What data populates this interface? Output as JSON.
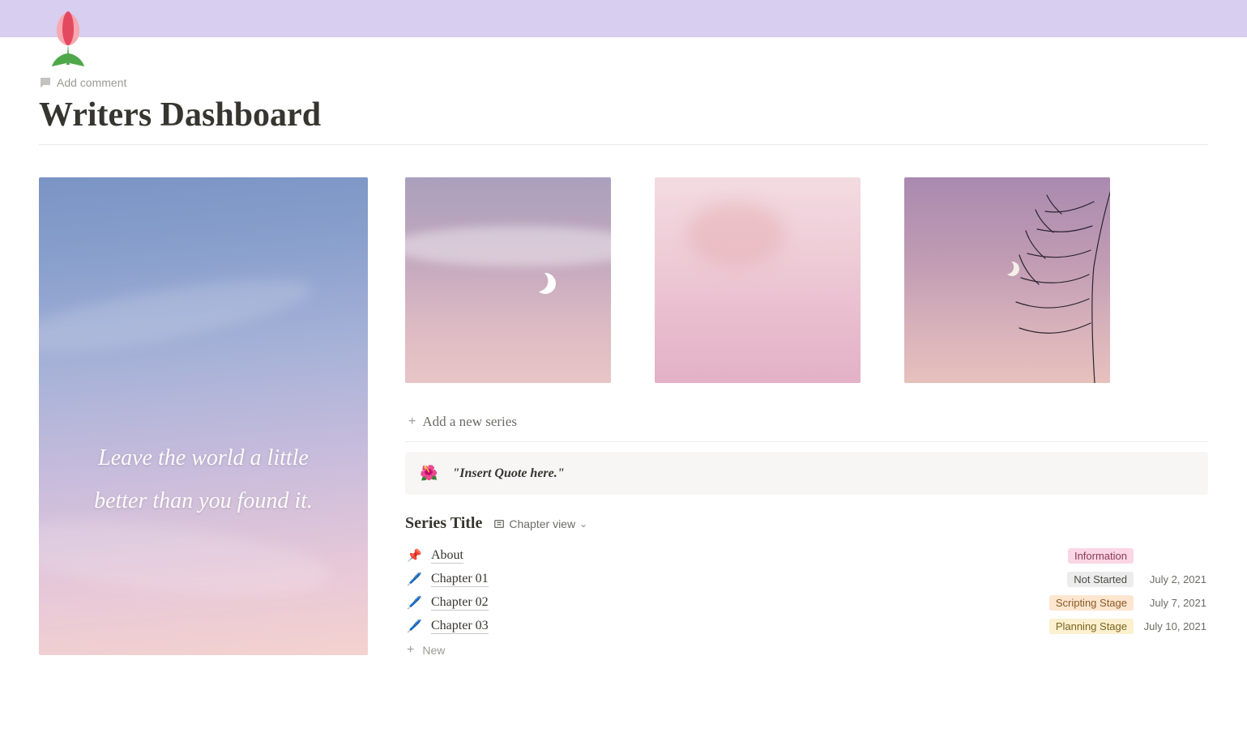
{
  "header": {
    "add_comment_label": "Add comment",
    "page_title": "Writers Dashboard"
  },
  "left_image": {
    "quote_line1": "Leave the world a little",
    "quote_line2": "better than you found it."
  },
  "right": {
    "add_series_label": "Add a new series",
    "callout": {
      "emoji": "🌺",
      "text": "\"Insert Quote here.\""
    },
    "series_db": {
      "title": "Series Title",
      "view_label": "Chapter view",
      "rows": [
        {
          "icon": "📌",
          "title": "About",
          "tag": "Information",
          "tag_class": "tag-pink",
          "date": ""
        },
        {
          "icon": "🖊️",
          "title": "Chapter 01",
          "tag": "Not Started",
          "tag_class": "tag-grey",
          "date": "July 2, 2021"
        },
        {
          "icon": "🖊️",
          "title": "Chapter 02",
          "tag": "Scripting Stage",
          "tag_class": "tag-orange",
          "date": "July 7, 2021"
        },
        {
          "icon": "🖊️",
          "title": "Chapter 03",
          "tag": "Planning Stage",
          "tag_class": "tag-yellow",
          "date": "July 10, 2021"
        }
      ],
      "new_label": "New"
    }
  }
}
